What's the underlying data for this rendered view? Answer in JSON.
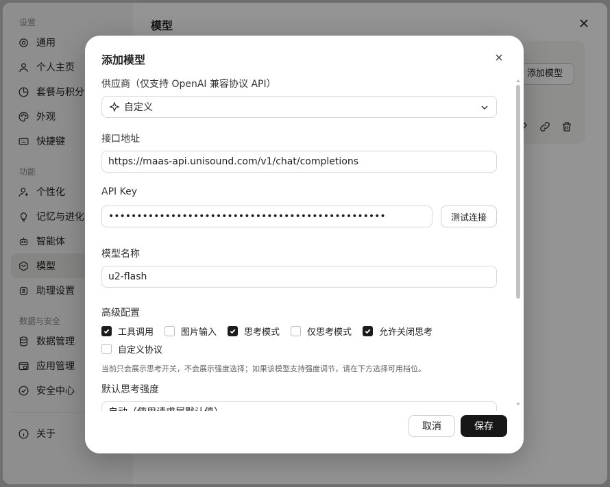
{
  "settings": {
    "sidebar": {
      "groups": [
        {
          "title": "设置",
          "items": [
            {
              "label": "通用",
              "icon": "gear-icon"
            },
            {
              "label": "个人主页",
              "icon": "user-icon"
            },
            {
              "label": "套餐与积分",
              "icon": "pie-chart-icon"
            },
            {
              "label": "外观",
              "icon": "palette-icon"
            },
            {
              "label": "快捷键",
              "icon": "keyboard-icon"
            }
          ]
        },
        {
          "title": "功能",
          "items": [
            {
              "label": "个性化",
              "icon": "user-sparkle-icon"
            },
            {
              "label": "记忆与进化",
              "icon": "lightbulb-icon"
            },
            {
              "label": "智能体",
              "icon": "robot-icon"
            },
            {
              "label": "模型",
              "icon": "hexagon-icon",
              "active": true
            },
            {
              "label": "助理设置",
              "icon": "assistant-icon"
            }
          ]
        },
        {
          "title": "数据与安全",
          "items": [
            {
              "label": "数据管理",
              "icon": "database-icon"
            },
            {
              "label": "应用管理",
              "icon": "app-window-icon"
            },
            {
              "label": "安全中心",
              "icon": "shield-check-icon"
            }
          ]
        }
      ],
      "footer_item": {
        "label": "关于",
        "icon": "info-icon"
      }
    },
    "main": {
      "title": "模型",
      "add_model_label": "添加模型"
    }
  },
  "dialog": {
    "title": "添加模型",
    "provider": {
      "label": "供应商（仅支持 OpenAI 兼容协议 API）",
      "value": "自定义"
    },
    "endpoint": {
      "label": "接口地址",
      "value": "https://maas-api.unisound.com/v1/chat/completions"
    },
    "api_key": {
      "label": "API Key",
      "value": "•••••••••••••••••••••••••••••••••••••••••••••••••",
      "test_label": "测试连接"
    },
    "model_name": {
      "label": "模型名称",
      "value": "u2-flash"
    },
    "advanced": {
      "label": "高级配置",
      "options": [
        {
          "label": "工具调用",
          "checked": true
        },
        {
          "label": "图片输入",
          "checked": false
        },
        {
          "label": "思考模式",
          "checked": true
        },
        {
          "label": "仅思考模式",
          "checked": false
        },
        {
          "label": "允许关闭思考",
          "checked": true
        },
        {
          "label": "自定义协议",
          "checked": false
        }
      ],
      "hint": "当前只会展示思考开关，不会展示强度选择；如果该模型支持强度调节，请在下方选择可用档位。"
    },
    "default_strength": {
      "label": "默认思考强度",
      "value": "自动（使用请求层默认值）"
    },
    "cancel_label": "取消",
    "save_label": "保存"
  },
  "colors": {
    "accent": "#171717",
    "overlay": "#6f6f6f"
  }
}
